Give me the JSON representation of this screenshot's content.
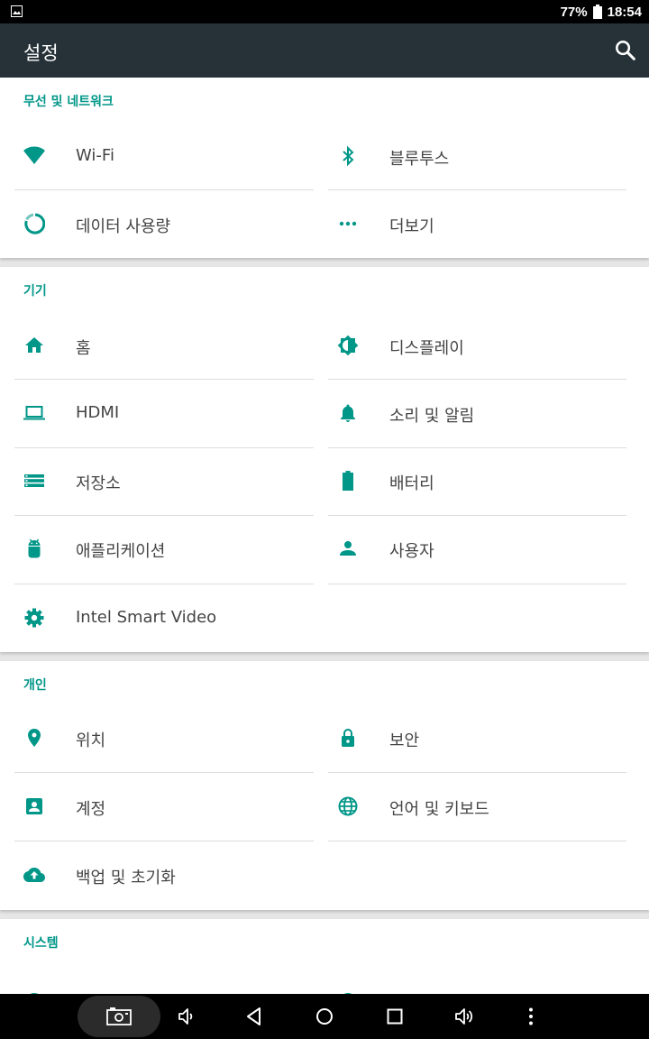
{
  "status_bar": {
    "battery_percent": "77%",
    "time": "18:54"
  },
  "app_bar": {
    "title": "설정",
    "search_icon": "search-icon"
  },
  "colors": {
    "accent": "#009688",
    "app_bar": "#263238"
  },
  "sections": {
    "wireless": {
      "header": "무선 및 네트워크",
      "items": {
        "wifi": {
          "label": "Wi-Fi",
          "icon": "wifi-icon"
        },
        "bluetooth": {
          "label": "블루투스",
          "icon": "bluetooth-icon"
        },
        "data_usage": {
          "label": "데이터 사용량",
          "icon": "data-usage-icon"
        },
        "more": {
          "label": "더보기",
          "icon": "more-horiz-icon"
        }
      }
    },
    "device": {
      "header": "기기",
      "items": {
        "home": {
          "label": "홈",
          "icon": "home-icon"
        },
        "display": {
          "label": "디스플레이",
          "icon": "brightness-icon"
        },
        "hdmi": {
          "label": "HDMI",
          "icon": "laptop-icon"
        },
        "sound": {
          "label": "소리 및 알림",
          "icon": "bell-icon"
        },
        "storage": {
          "label": "저장소",
          "icon": "storage-icon"
        },
        "battery": {
          "label": "배터리",
          "icon": "battery-icon"
        },
        "apps": {
          "label": "애플리케이션",
          "icon": "android-icon"
        },
        "users": {
          "label": "사용자",
          "icon": "person-icon"
        },
        "intel_video": {
          "label": "Intel Smart Video",
          "icon": "gear-icon"
        }
      }
    },
    "personal": {
      "header": "개인",
      "items": {
        "location": {
          "label": "위치",
          "icon": "location-pin-icon"
        },
        "security": {
          "label": "보안",
          "icon": "lock-icon"
        },
        "accounts": {
          "label": "계정",
          "icon": "account-box-icon"
        },
        "language": {
          "label": "언어 및 키보드",
          "icon": "globe-icon"
        },
        "backup": {
          "label": "백업 및 초기화",
          "icon": "cloud-upload-icon"
        }
      }
    },
    "system": {
      "header": "시스템"
    }
  },
  "nav_bar": {
    "buttons": [
      "screenshot-icon",
      "volume-down-icon",
      "back-icon",
      "home-circle-icon",
      "recents-icon",
      "volume-up-icon",
      "more-vert-icon"
    ]
  }
}
